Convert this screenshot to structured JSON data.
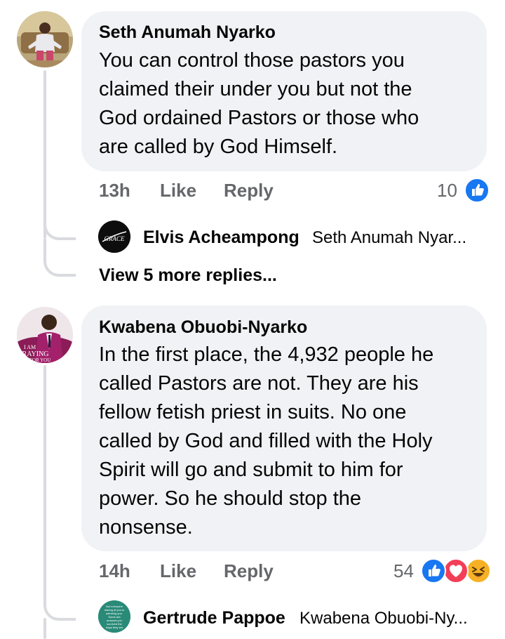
{
  "comments": [
    {
      "author": "Seth Anumah Nyarko",
      "text_lines": [
        "You can control those pastors you",
        "claimed their under you but not the",
        "God ordained Pastors or those who",
        "are called by God Himself."
      ],
      "time": "13h",
      "like_label": "Like",
      "reply_label": "Reply",
      "reaction_count": "10",
      "reactions": [
        "like-icon"
      ],
      "reply_preview": {
        "author": "Elvis Acheampong",
        "text": "Seth Anumah Nyar...",
        "avatar_text": "GRACE"
      },
      "view_more": "View 5 more replies..."
    },
    {
      "author": "Kwabena Obuobi-Nyarko",
      "avatar_text": "I AM PRAYING FOR YOU",
      "text_lines": [
        "In the first place, the 4,932 people he",
        "called Pastors are not. They are his",
        "fellow fetish priest in suits. No one",
        "called by God and filled with the Holy",
        "Spirit will go and submit to him for",
        "power. So he should stop the",
        "nonsense."
      ],
      "time": "14h",
      "like_label": "Like",
      "reply_label": "Reply",
      "reaction_count": "54",
      "reactions": [
        "like-icon",
        "love-icon",
        "haha-icon"
      ],
      "reply_preview": {
        "author": "Gertrude Pappoe",
        "text": "Kwabena Obuobi-Ny...",
        "avatar_text": "Not everyone staring at you is admiring you. Some are amazed you survived the traps they set for you."
      }
    }
  ],
  "colors": {
    "bubble": "#f0f2f5",
    "thread_line": "#d9dbdf",
    "meta": "#65676b",
    "like_blue": "#1877f2",
    "love_red": "#f33e58",
    "haha_yellow": "#f7b125",
    "gertrude_avatar": "#2a8a78"
  }
}
